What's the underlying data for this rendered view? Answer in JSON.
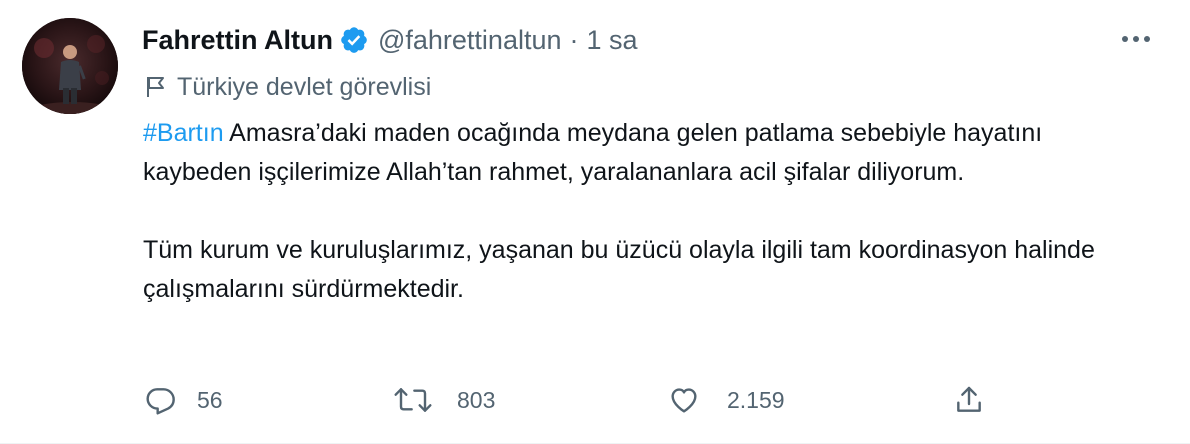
{
  "author": {
    "name": "Fahrettin Altun",
    "handle": "@fahrettinaltun",
    "separator": "·",
    "time": "1 sa"
  },
  "label": {
    "text": "Türkiye devlet görevlisi",
    "icon": "flag-icon"
  },
  "content": {
    "hashtag": "#Bartın",
    "paragraph1_rest": " Amasra’daki maden ocağında meydana gelen patlama sebebiyle hayatını kaybeden işçilerimize Allah’tan rahmet, yaralananlara acil şifalar diliyorum.",
    "paragraph2": "Tüm kurum ve kuruluşlarımız, yaşanan bu üzücü olayla ilgili tam koordinasyon halinde çalışmalarını sürdürmektedir."
  },
  "actions": {
    "reply": {
      "icon": "reply-icon",
      "count": "56"
    },
    "retweet": {
      "icon": "retweet-icon",
      "count": "803"
    },
    "like": {
      "icon": "heart-icon",
      "count": "2.159"
    },
    "share": {
      "icon": "share-icon"
    }
  },
  "colors": {
    "text": "#0f1419",
    "secondary": "#536471",
    "accent": "#1d9bf0"
  }
}
